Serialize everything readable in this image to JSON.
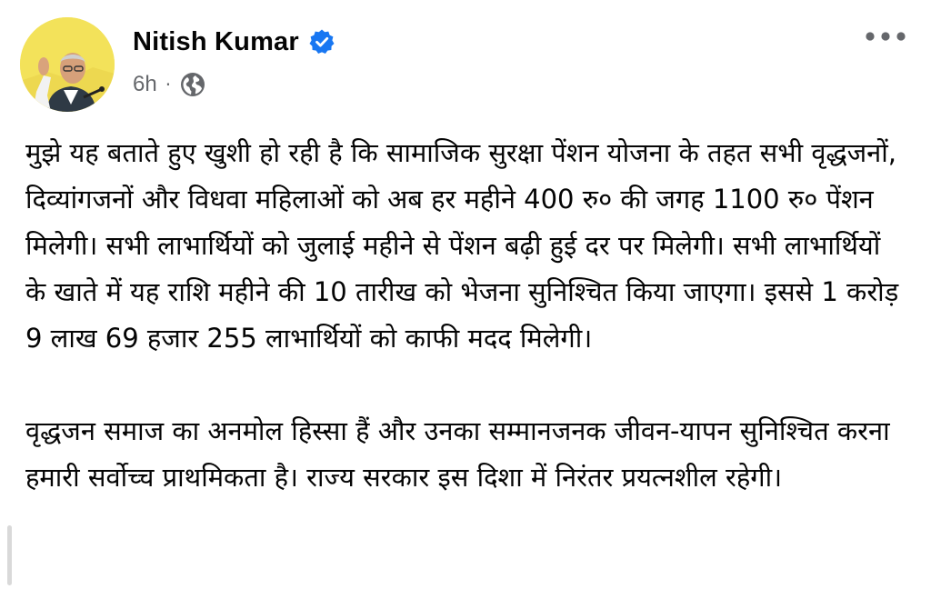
{
  "post": {
    "author": "Nitish Kumar",
    "verified": true,
    "time": "6h",
    "separator": "·",
    "audience_icon": "globe-icon",
    "more_icon": "more-options-icon",
    "paragraphs": [
      "मुझे यह बताते हुए खुशी हो रही है कि सामाजिक सुरक्षा पेंशन योजना के तहत सभी वृद्धजनों, दिव्यांगजनों और विधवा महिलाओं को अब हर महीने 400 रु० की जगह 1100 रु० पेंशन मिलेगी। सभी लाभार्थियों को जुलाई महीने से पेंशन बढ़ी हुई दर पर मिलेगी। सभी लाभार्थियों के खाते में यह राशि महीने की 10 तारीख को भेजना सुनिश्चित किया जाएगा। इससे 1 करोड़ 9 लाख 69 हजार 255 लाभार्थियों को काफी मदद मिलेगी।",
      "वृद्धजन समाज का अनमोल हिस्सा हैं और उनका सम्मानजनक जीवन-यापन सुनिश्चित करना हमारी सर्वोच्च प्राथमिकता है। राज्य सरकार इस दिशा में निरंतर प्रयत्नशील रहेगी।"
    ]
  },
  "colors": {
    "verified_badge": "#1877f2",
    "meta_gray": "#65676b",
    "text": "#050505",
    "avatar_bg": "#f5e663"
  }
}
